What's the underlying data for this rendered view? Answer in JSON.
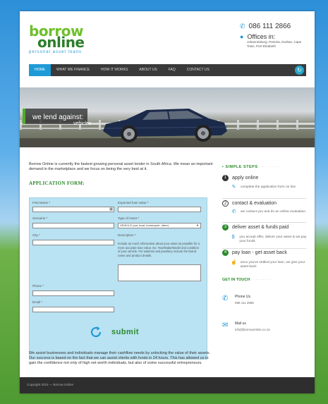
{
  "logo": {
    "line1": "borrow",
    "line2": "online",
    "tagline": "personal asset loans"
  },
  "contact": {
    "phone": "086 111 2866",
    "office_title": "Offices in:",
    "office_address": "Johannesburg, Pretoria, Durban, Cape Town, Port Elizabeth"
  },
  "nav": {
    "items": [
      "HOME",
      "WHAT WE FINANCE",
      "HOW IT WORKS",
      "ABOUT US",
      "FAQ",
      "CONTACT US"
    ]
  },
  "banner": {
    "title": "we lend against:",
    "subtitle": "vehicles"
  },
  "intro": "Borrow Online is currently the fastest growing personal asset lender in South Africa. We mean an important demand in the marketplace and we focus on being the very best at it.",
  "form": {
    "heading": "APPLICATION FORM:",
    "labels": {
      "first_name": "First Name *",
      "surname": "Surname *",
      "city": "City *",
      "phone": "Phone *",
      "email": "Email *",
      "expected_value": "Expected loan value *",
      "asset_type": "Type of Asset *",
      "description": "Description *"
    },
    "asset_type_selected": "VEHICLE (car, boat, motorcycle, other)",
    "description_help": "Include as much information about your asset as possible for a more accurate loan value. Ex: Year/Make/Model and condition of your vehicle. For watches and jewellery include the brand name and product details.",
    "submit_label": "submit"
  },
  "outro": "We assist businesses and individuals manage their cashflow needs by unlocking the value of their assets. Our success is based on the fact that we can assist clients with funds in 24 hours. This has allowed us to gain the confidence not only of high net worth individuals, but also of some successful entrepreneurs.",
  "sidebar": {
    "steps_title": "SIMPLE STEPS",
    "steps": [
      {
        "num": "1",
        "label": "apply online",
        "desc": "complete the application form on line"
      },
      {
        "num": "2",
        "label": "contact & evaluation",
        "desc": "we contact you and do an online evaluation"
      },
      {
        "num": "3",
        "label": "deliver asset & funds paid",
        "desc": "you accept offer, deliver your asset & we pay your funds"
      },
      {
        "num": "4",
        "label": "pay loan - get asset back",
        "desc": "once you've settled your loan, we give your asset back"
      }
    ],
    "touch_title": "GET IN TOUCH",
    "phone_label": "Phone Us",
    "phone_value": "086 111 2866",
    "mail_label": "Mail us",
    "mail_value": "info@borrowonline.co.za"
  },
  "footer": {
    "text": "Copyright 2015 — Borrow Online"
  },
  "colors": {
    "brand_green": "#2b8a2b",
    "accent_blue": "#1e9ad6",
    "nav_dark": "#3a3a3a",
    "form_bg": "#b9e2f2"
  }
}
